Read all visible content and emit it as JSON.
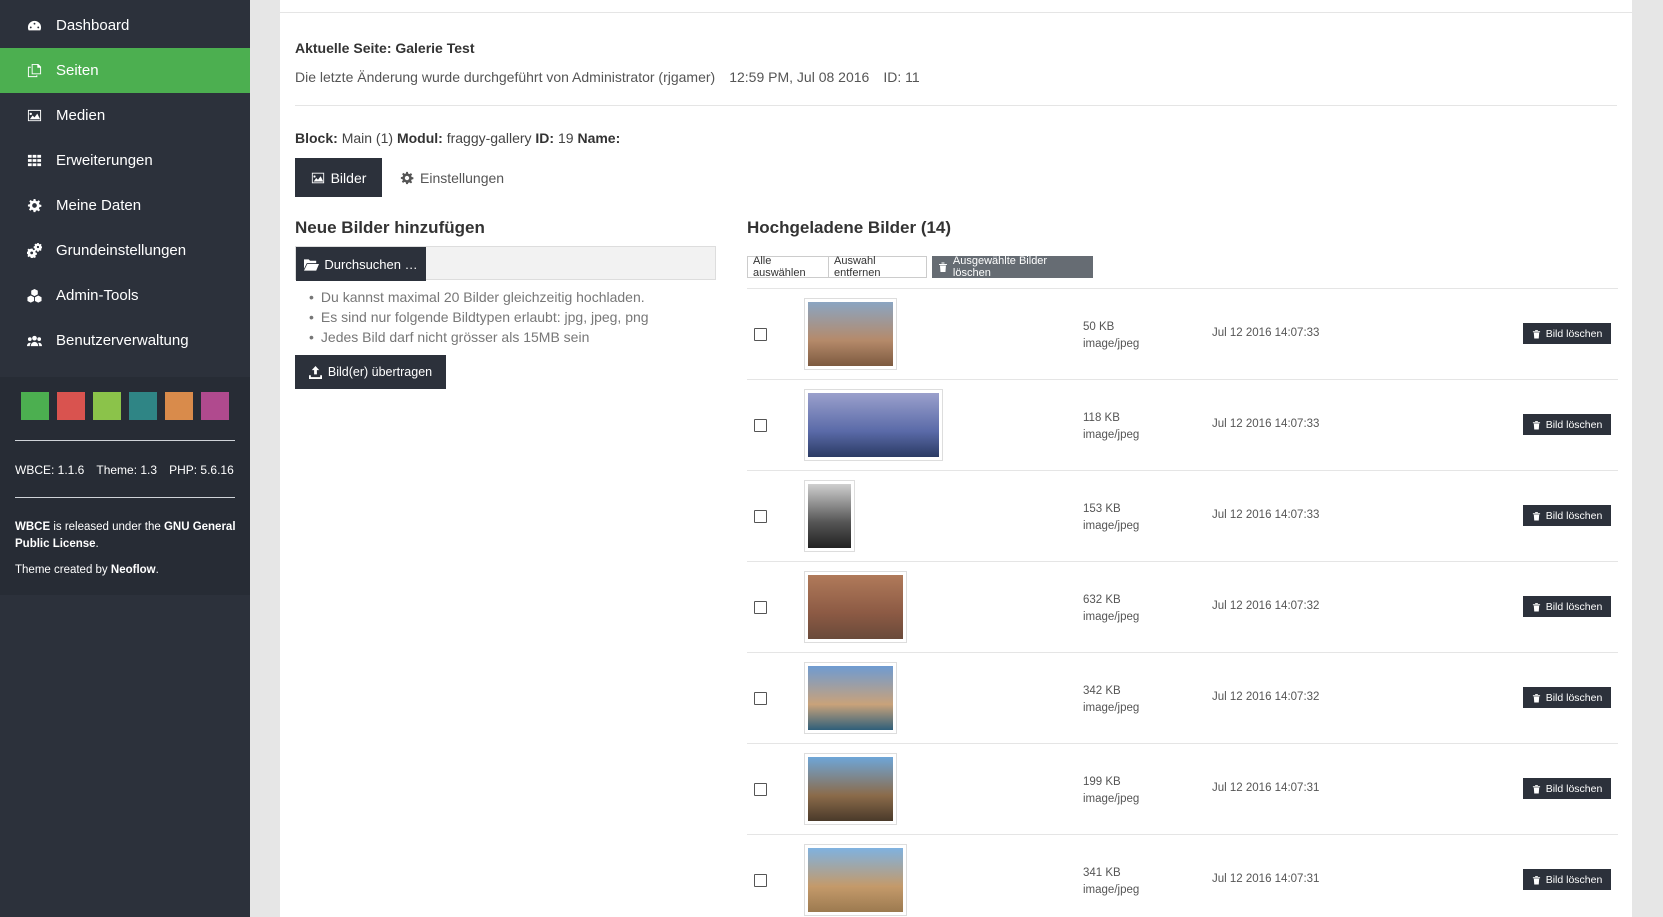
{
  "sidebar": {
    "items": [
      {
        "label": "Dashboard",
        "icon": "dashboard-icon"
      },
      {
        "label": "Seiten",
        "icon": "pages-icon",
        "active": true
      },
      {
        "label": "Medien",
        "icon": "image-icon"
      },
      {
        "label": "Erweiterungen",
        "icon": "grid-icon"
      },
      {
        "label": "Meine Daten",
        "icon": "gear-icon"
      },
      {
        "label": "Grundeinstellungen",
        "icon": "gears-icon"
      },
      {
        "label": "Admin-Tools",
        "icon": "cubes-icon"
      },
      {
        "label": "Benutzerverwaltung",
        "icon": "users-icon"
      }
    ],
    "swatches": [
      "#4caf50",
      "#d9534f",
      "#8bc34a",
      "#2f8585",
      "#d98b4b",
      "#b04a8e"
    ],
    "versions": {
      "wbce": "WBCE: 1.1.6",
      "theme": "Theme: 1.3",
      "php": "PHP: 5.6.16"
    },
    "license": {
      "product": "WBCE",
      "text": " is released under the ",
      "link": "GNU General Public License",
      "end": "."
    },
    "credit": {
      "prefix": "Theme created by ",
      "author": "Neoflow",
      "end": "."
    }
  },
  "page": {
    "title": "Aktuelle Seite: Galerie Test",
    "meta_changed": "Die letzte Änderung wurde durchgeführt von Administrator (rjgamer)",
    "meta_time": "12:59 PM, Jul 08 2016",
    "meta_id": "ID: 11",
    "block": {
      "block_label": "Block:",
      "block_value": "Main (1)",
      "modul_label": "Modul:",
      "modul_value": "fraggy-gallery",
      "id_label": "ID:",
      "id_value": "19",
      "name_label": "Name:"
    }
  },
  "tabs": {
    "bilder": "Bilder",
    "settings": "Einstellungen"
  },
  "upload": {
    "heading": "Neue Bilder hinzufügen",
    "browse": "Durchsuchen …",
    "hints": [
      "Du kannst maximal 20 Bilder gleichzeitig hochladen.",
      "Es sind nur folgende Bildtypen erlaubt: jpg, jpeg, png",
      "Jedes Bild darf nicht grösser als 15MB sein"
    ],
    "submit": "Bild(er) übertragen"
  },
  "gallery": {
    "heading": "Hochgeladene Bilder (14)",
    "select_all": "Alle auswählen",
    "deselect": "Auswahl entfernen",
    "delete_selected": "Ausgewählte Bilder löschen",
    "delete_label": "Bild löschen",
    "images": [
      {
        "size": "50 KB",
        "type": "image/jpeg",
        "date": "Jul 12 2016 14:07:33",
        "colors": [
          "#8aa5c2",
          "#b58a6a",
          "#7d5a40"
        ]
      },
      {
        "size": "118 KB",
        "type": "image/jpeg",
        "date": "Jul 12 2016 14:07:33",
        "colors": [
          "#9aa0cc",
          "#5a6aa8",
          "#2b3b64"
        ]
      },
      {
        "size": "153 KB",
        "type": "image/jpeg",
        "date": "Jul 12 2016 14:07:33",
        "colors": [
          "#cfcfcf",
          "#555555",
          "#222222"
        ]
      },
      {
        "size": "632 KB",
        "type": "image/jpeg",
        "date": "Jul 12 2016 14:07:32",
        "colors": [
          "#b07a5a",
          "#8c5a44",
          "#6a4a3a"
        ]
      },
      {
        "size": "342 KB",
        "type": "image/jpeg",
        "date": "Jul 12 2016 14:07:32",
        "colors": [
          "#6f9bd1",
          "#c9a27a",
          "#2f5f7a"
        ]
      },
      {
        "size": "199 KB",
        "type": "image/jpeg",
        "date": "Jul 12 2016 14:07:31",
        "colors": [
          "#6ea6d8",
          "#8b6b4a",
          "#4a3a2a"
        ]
      },
      {
        "size": "341 KB",
        "type": "image/jpeg",
        "date": "Jul 12 2016 14:07:31",
        "colors": [
          "#7fb2e0",
          "#c49a6a",
          "#9c7a50"
        ]
      }
    ]
  }
}
